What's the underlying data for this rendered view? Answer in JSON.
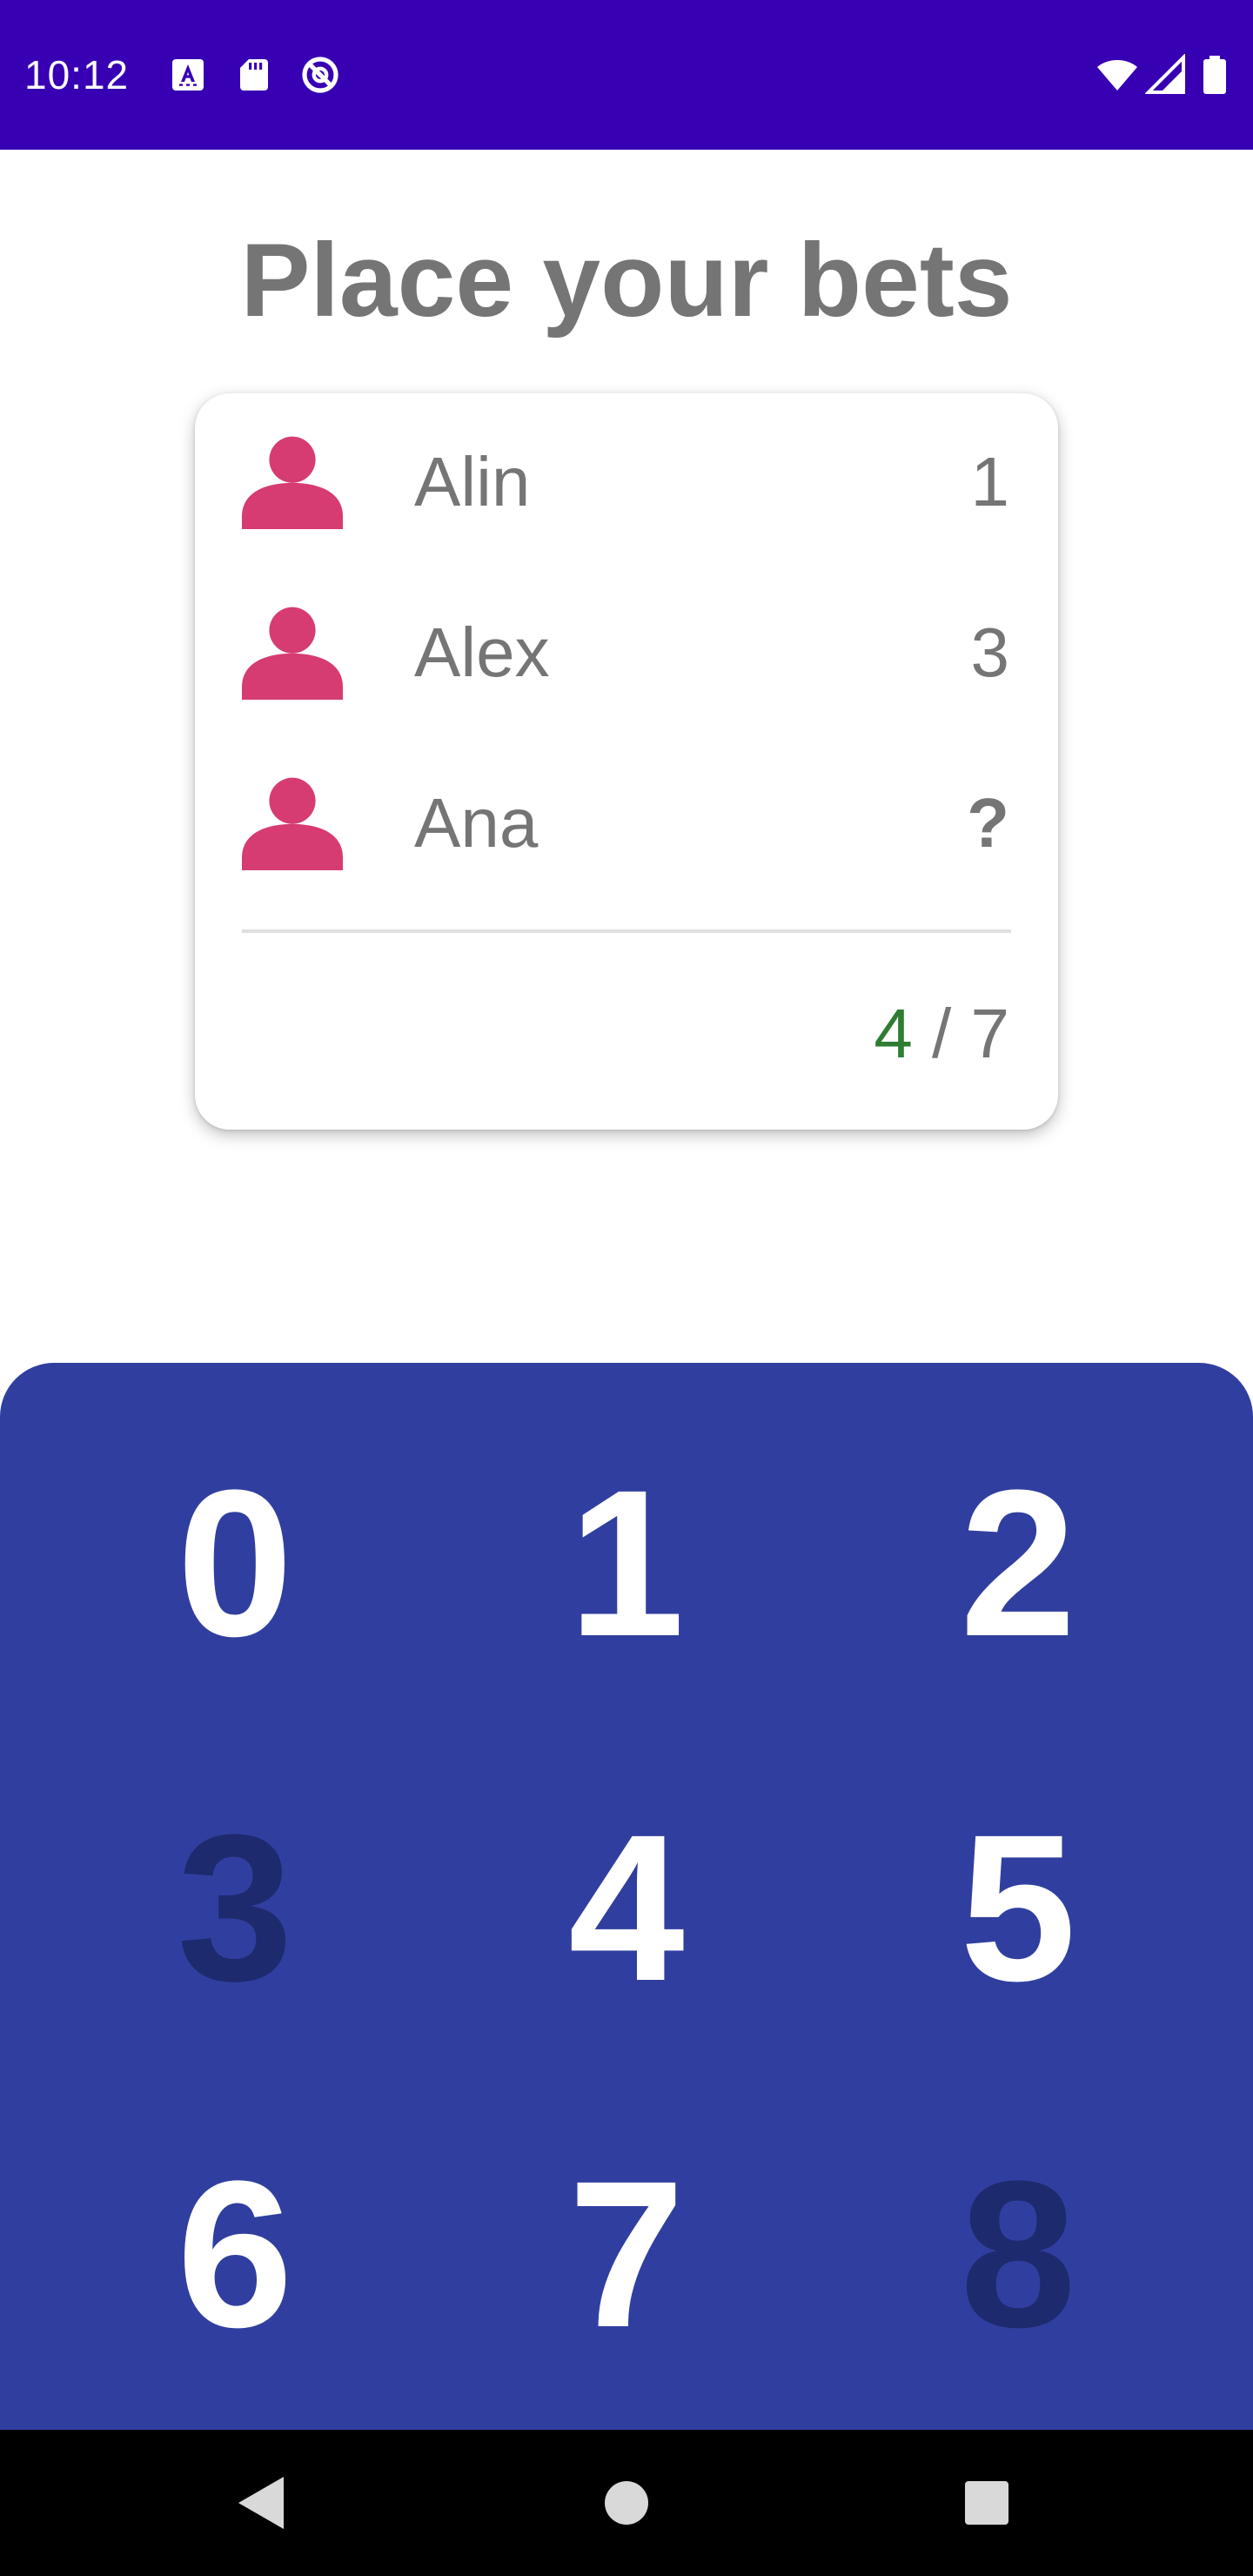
{
  "status_bar": {
    "time": "10:12",
    "left_icons": [
      "keyboard-a-icon",
      "sd-card-icon",
      "do-not-disturb-icon"
    ],
    "right_icons": [
      "wifi-icon",
      "signal-icon",
      "battery-icon"
    ],
    "background": "#3700b3"
  },
  "title": "Place your bets",
  "players": [
    {
      "name": "Alin",
      "bet": "1"
    },
    {
      "name": "Alex",
      "bet": "3"
    },
    {
      "name": "Ana",
      "bet": "?"
    }
  ],
  "total": {
    "current": "4",
    "separator": " / ",
    "max": "7"
  },
  "number_pad": {
    "keys": [
      {
        "label": "0",
        "enabled": true
      },
      {
        "label": "1",
        "enabled": true
      },
      {
        "label": "2",
        "enabled": true
      },
      {
        "label": "3",
        "enabled": false
      },
      {
        "label": "4",
        "enabled": true
      },
      {
        "label": "5",
        "enabled": true
      },
      {
        "label": "6",
        "enabled": true
      },
      {
        "label": "7",
        "enabled": true
      },
      {
        "label": "8",
        "enabled": false
      }
    ]
  },
  "colors": {
    "avatar": "#d63b72",
    "pad_background": "#303f9f",
    "key_enabled": "#ffffff",
    "key_disabled": "#1e2a6e",
    "total_current": "#2e7d32",
    "text_gray": "#757575"
  },
  "nav_bar": {
    "buttons": [
      "back-icon",
      "home-icon",
      "recents-icon"
    ]
  }
}
